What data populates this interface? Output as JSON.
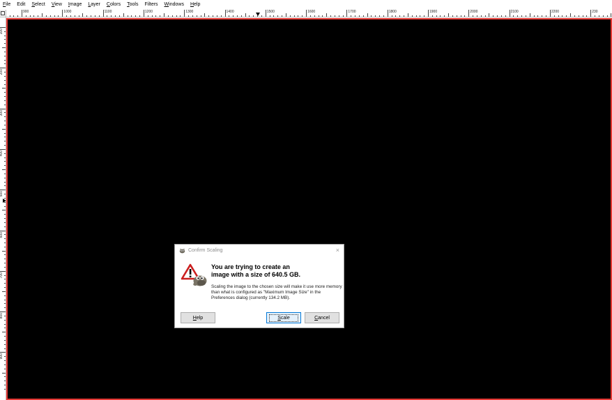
{
  "menu": [
    {
      "mnemonic": "F",
      "rest": "ile"
    },
    {
      "mnemonic": "",
      "rest": "Edit"
    },
    {
      "mnemonic": "S",
      "rest": "elect"
    },
    {
      "mnemonic": "V",
      "rest": "iew"
    },
    {
      "mnemonic": "I",
      "rest": "mage"
    },
    {
      "mnemonic": "L",
      "rest": "ayer"
    },
    {
      "mnemonic": "C",
      "rest": "olors"
    },
    {
      "mnemonic": "T",
      "rest": "ools"
    },
    {
      "mnemonic": "",
      "rest": "Filters"
    },
    {
      "mnemonic": "W",
      "rest": "indows"
    },
    {
      "mnemonic": "H",
      "rest": "elp"
    }
  ],
  "ruler": {
    "horizontal_labels": [
      "900",
      "1000",
      "1100",
      "1200",
      "1300",
      "1400",
      "1500",
      "1600",
      "1700",
      "1800",
      "1900",
      "2000",
      "2100",
      "2200",
      "230"
    ],
    "vertical_labels": [
      "100",
      "200",
      "300",
      "400",
      "500",
      "600",
      "700",
      "800",
      "900"
    ]
  },
  "dialog": {
    "title": "Confirm Scaling",
    "close_glyph": "×",
    "heading_line1": "You are trying to create an",
    "heading_line2": "image with a size of 640.5 GB.",
    "body": "Scaling the image to the chosen size will make it use more memory than what is configured as \"Maximum Image Size\" in the Preferences dialog (currently 134.2 MB).",
    "help": {
      "mnemonic": "H",
      "rest": "elp"
    },
    "scale": {
      "mnemonic": "S",
      "rest": "cale"
    },
    "cancel": {
      "mnemonic": "C",
      "rest": "ancel"
    }
  },
  "colors": {
    "canvas": "#000000",
    "canvas_border": "#e53935",
    "accent": "#0078d7"
  },
  "icons": {
    "corner": "quick-mask-icon",
    "dialog_app": "gimp-wilber-icon",
    "warning": "warning-triangle-icon",
    "close": "close-icon"
  }
}
